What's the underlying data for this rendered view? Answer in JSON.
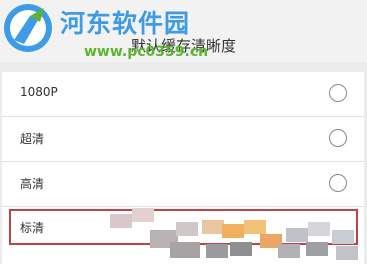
{
  "page_title": "默认缓存清晰度",
  "watermark": {
    "site_name": "河东软件园",
    "url": "www.pc0359.cn"
  },
  "options": [
    {
      "label": "1080P"
    },
    {
      "label": "超清"
    },
    {
      "label": "高清"
    },
    {
      "label": "标清"
    }
  ],
  "colors": {
    "highlight_border": "#c0434c",
    "watermark_blue": "#3d9be8",
    "watermark_green": "#5cb531"
  }
}
